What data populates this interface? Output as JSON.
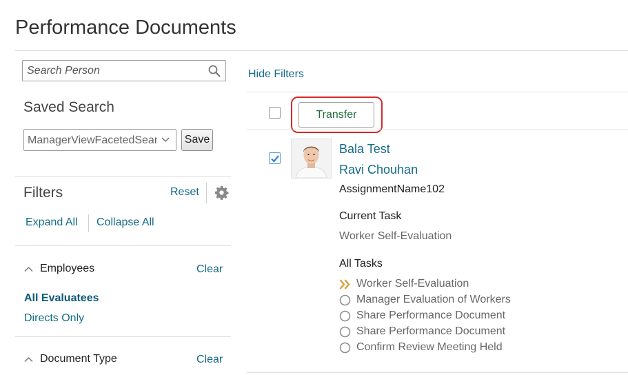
{
  "page": {
    "title": "Performance Documents"
  },
  "search": {
    "placeholder": "Search Person"
  },
  "saved_search": {
    "label": "Saved Search",
    "selected": "ManagerViewFacetedSearch",
    "save_label": "Save"
  },
  "filters": {
    "label": "Filters",
    "reset_label": "Reset",
    "expand_all_label": "Expand All",
    "collapse_all_label": "Collapse All",
    "sections": [
      {
        "label": "Employees",
        "clear_label": "Clear",
        "options": [
          {
            "label": "All Evaluatees",
            "selected": true
          },
          {
            "label": "Directs Only",
            "selected": false
          }
        ]
      },
      {
        "label": "Document Type",
        "clear_label": "Clear"
      }
    ]
  },
  "toolbar": {
    "hide_filters_label": "Hide Filters",
    "transfer_label": "Transfer",
    "select_all_checked": false
  },
  "results": [
    {
      "checked": true,
      "primary_name": "Bala Test",
      "secondary_name": "Ravi Chouhan",
      "assignment": "AssignmentName102",
      "current_task_heading": "Current Task",
      "current_task": "Worker Self-Evaluation",
      "all_tasks_heading": "All Tasks",
      "tasks": [
        {
          "label": "Worker Self-Evaluation",
          "status": "current",
          "icon": "double-chevron-right-icon"
        },
        {
          "label": "Manager Evaluation of Workers",
          "status": "pending",
          "icon": "circle-icon"
        },
        {
          "label": "Share Performance Document",
          "status": "pending",
          "icon": "circle-icon"
        },
        {
          "label": "Share Performance Document",
          "status": "pending",
          "icon": "circle-icon"
        },
        {
          "label": "Confirm Review Meeting Held",
          "status": "pending",
          "icon": "circle-icon"
        }
      ]
    }
  ],
  "colors": {
    "link": "#146b87",
    "highlight_outline": "#d42a2a",
    "current_task_icon": "#d9a13b",
    "checkbox_check": "#2f7fd1"
  }
}
